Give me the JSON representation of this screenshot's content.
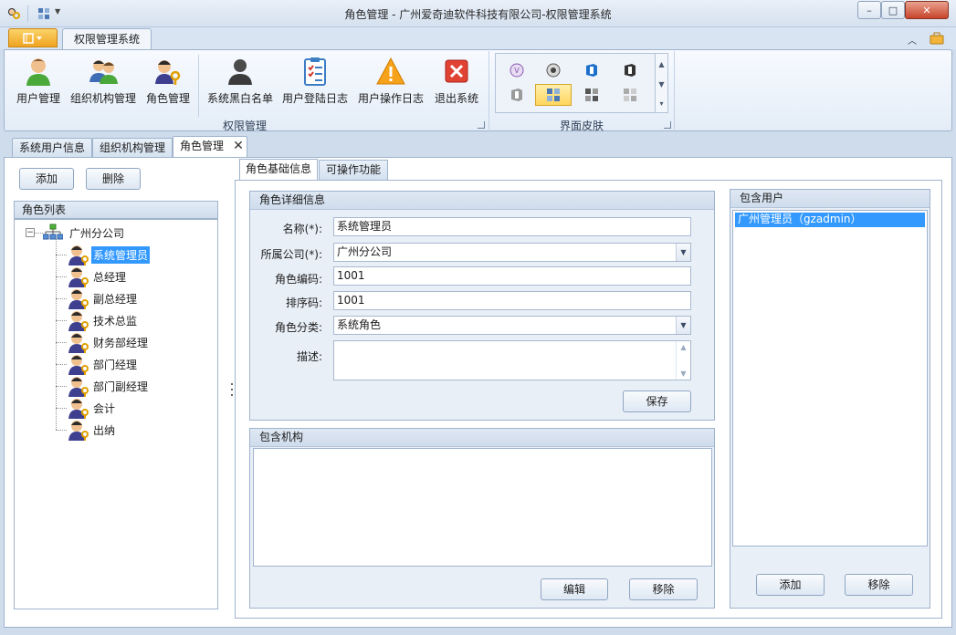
{
  "window": {
    "title": "角色管理 - 广州爱奇迪软件科技有限公司-权限管理系统",
    "minimize": "–",
    "maximize": "□",
    "close": "✕"
  },
  "ribbon": {
    "tab": "权限管理系统",
    "group_label": "权限管理",
    "skin_group_label": "界面皮肤",
    "buttons": [
      {
        "label": "用户管理",
        "icon": "user-icon"
      },
      {
        "label": "组织机构管理",
        "icon": "organization-icon"
      },
      {
        "label": "角色管理",
        "icon": "role-key-icon"
      },
      {
        "label": "系统黑白名单",
        "icon": "person-silhouette-icon"
      },
      {
        "label": "用户登陆日志",
        "icon": "checklist-icon"
      },
      {
        "label": "用户操作日志",
        "icon": "warning-icon"
      },
      {
        "label": "退出系统",
        "icon": "exit-icon"
      }
    ],
    "scroll_up": "▲",
    "scroll_down": "▼",
    "scroll_more": "▾"
  },
  "doc_tabs": [
    {
      "label": "系统用户信息"
    },
    {
      "label": "组织机构管理"
    },
    {
      "label": "角色管理",
      "active": true
    }
  ],
  "doc_tab_close": "✕",
  "left": {
    "add_label": "添加",
    "delete_label": "删除",
    "list_header": "角色列表",
    "root": "广州分公司",
    "collapse_glyph": "−",
    "roles": [
      "系统管理员",
      "总经理",
      "副总经理",
      "技术总监",
      "财务部经理",
      "部门经理",
      "部门副经理",
      "会计",
      "出纳"
    ],
    "selected_index": 0
  },
  "inner_tabs": [
    {
      "label": "角色基础信息",
      "active": true
    },
    {
      "label": "可操作功能"
    }
  ],
  "details": {
    "header": "角色详细信息",
    "name_label": "名称(*):",
    "name_value": "系统管理员",
    "company_label": "所属公司(*):",
    "company_value": "广州分公司",
    "code_label": "角色编码:",
    "code_value": "1001",
    "sort_label": "排序码:",
    "sort_value": "1001",
    "category_label": "角色分类:",
    "category_value": "系统角色",
    "desc_label": "描述:",
    "desc_value": "",
    "save_label": "保存",
    "dropdown_glyph": "▼",
    "scroll_up": "▲",
    "scroll_down": "▼"
  },
  "orgs": {
    "header": "包含机构",
    "edit_label": "编辑",
    "remove_label": "移除"
  },
  "users": {
    "header": "包含用户",
    "items": [
      "广州管理员（gzadmin）"
    ],
    "add_label": "添加",
    "remove_label": "移除"
  }
}
